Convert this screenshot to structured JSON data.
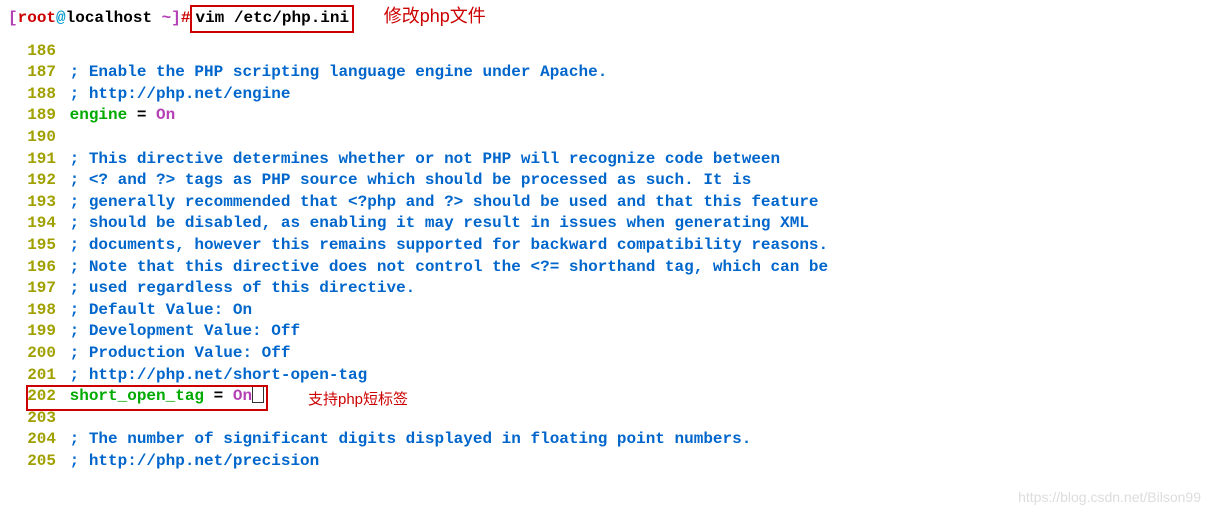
{
  "prompt": {
    "open": "[",
    "user": "root",
    "at": "@",
    "host": "localhost ",
    "path": "~",
    "close": "]",
    "hash": "#",
    "command": " vim /etc/php.ini"
  },
  "annotation1": "修改php文件",
  "annotation2": "支持php短标签",
  "lines": [
    {
      "num": "186",
      "text": ""
    },
    {
      "num": "187",
      "text": "; Enable the PHP scripting language engine under Apache."
    },
    {
      "num": "188",
      "text": "; http://php.net/engine"
    },
    {
      "num": "189",
      "directive": "engine",
      "eq": " = ",
      "value": "On"
    },
    {
      "num": "190",
      "text": ""
    },
    {
      "num": "191",
      "text": "; This directive determines whether or not PHP will recognize code between"
    },
    {
      "num": "192",
      "text": "; <? and ?> tags as PHP source which should be processed as such. It is"
    },
    {
      "num": "193",
      "text": "; generally recommended that <?php and ?> should be used and that this feature"
    },
    {
      "num": "194",
      "text": "; should be disabled, as enabling it may result in issues when generating XML"
    },
    {
      "num": "195",
      "text": "; documents, however this remains supported for backward compatibility reasons."
    },
    {
      "num": "196",
      "text": "; Note that this directive does not control the <?= shorthand tag, which can be"
    },
    {
      "num": "197",
      "text": "; used regardless of this directive."
    },
    {
      "num": "198",
      "text": "; Default Value: On"
    },
    {
      "num": "199",
      "text": "; Development Value: Off"
    },
    {
      "num": "200",
      "text": "; Production Value: Off"
    },
    {
      "num": "201",
      "text": "; http://php.net/short-open-tag"
    },
    {
      "num": "202",
      "directive": "short_open_tag",
      "eq": " = ",
      "value": "On",
      "boxed": true
    },
    {
      "num": "203",
      "text": ""
    },
    {
      "num": "204",
      "text": "; The number of significant digits displayed in floating point numbers."
    },
    {
      "num": "205",
      "text": "; http://php.net/precision"
    }
  ],
  "watermark": "https://blog.csdn.net/Bilson99"
}
